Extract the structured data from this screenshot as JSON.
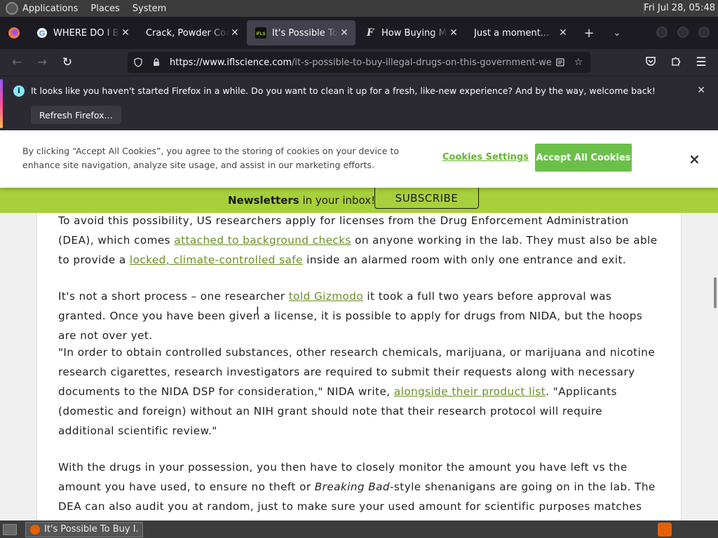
{
  "top_panel": {
    "menus": [
      "Applications",
      "Places",
      "System"
    ],
    "clock": "Fri Jul 28, 05:48"
  },
  "tabs": [
    {
      "title": "WHERE DO I BUY",
      "favicon": "G",
      "color": "#4285f4"
    },
    {
      "title": "Crack, Powder Cocaine",
      "favicon": "",
      "color": "#888888"
    },
    {
      "title": "It's Possible To Buy Illegal Drugs",
      "favicon": "IFLS",
      "color": "#a7d03c"
    },
    {
      "title": "How Buying My",
      "favicon": "F",
      "color": "#dddddd"
    },
    {
      "title": "Just a moment...",
      "favicon": "",
      "color": "#888888"
    }
  ],
  "navbar": {
    "url_host": "https://www.iflscience.com",
    "url_path": "/it-s-possible-to-buy-illegal-drugs-on-this-government-we"
  },
  "notification": {
    "message": "It looks like you haven't started Firefox in a while. Do you want to clean it up for a fresh, like-new experience? And by the way, welcome back!",
    "button": "Refresh Firefox…"
  },
  "cookie_banner": {
    "text": "By clicking “Accept All Cookies”, you agree to the storing of cookies on your device to enhance site navigation, analyze site usage, and assist in our marketing efforts.",
    "settings": "Cookies Settings",
    "accept": "Accept All Cookies",
    "close": "×"
  },
  "newsletter": {
    "bold": "Newsletters",
    "rest": " in your inbox!",
    "button": "SUBSCRIBE"
  },
  "article": {
    "p1": {
      "a": "To avoid this possibility, US researchers apply for licenses from the Drug Enforcement Administration (DEA), which comes ",
      "link1": "attached to background checks",
      "b": " on anyone working in the lab. They must also be able to provide a ",
      "link2": "locked, climate-controlled safe",
      "c": " inside an alarmed room with only one entrance and exit."
    },
    "p2": {
      "a": "It's not a short process – one researcher ",
      "link1": "told Gizmodo",
      "b": " it took a full two years before approval was granted. Once you have been given a license, it is possible to apply for drugs from NIDA, but the hoops are not over yet."
    },
    "p3": {
      "a": "\"In order to obtain controlled substances, other research chemicals, marijuana, or marijuana and nicotine research cigarettes, research investigators are required to submit their requests along with necessary documents to the NIDA DSP for consideration,\" NIDA write, ",
      "link1": "alongside their product list",
      "b": ". \"Applicants (domestic and foreign) without an NIH grant should note that their research protocol will require additional scientific review.\""
    },
    "p4": {
      "a": "With the drugs in your possession, you then have to closely monitor the amount you have left vs the amount you have used, to ensure no theft or ",
      "em": "Breaking Bad",
      "b": "-style shenanigans are going on in the lab. The DEA can also audit you at random, just to make sure your used amount for scientific purposes matches the amount used in"
    }
  },
  "taskbar": {
    "task_title": "It's Possible To Buy I..."
  }
}
